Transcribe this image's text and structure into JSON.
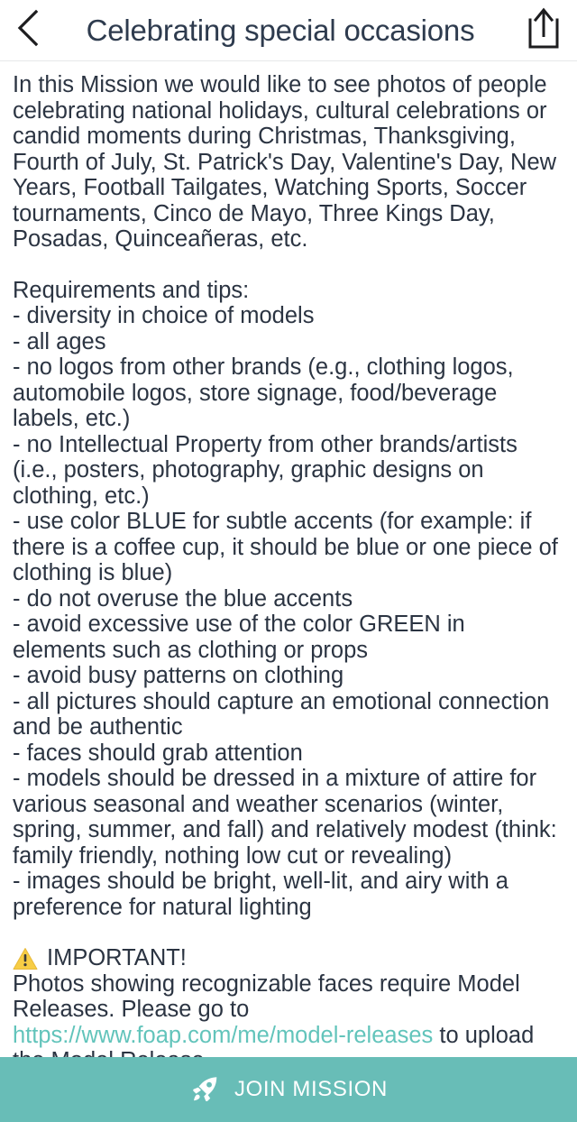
{
  "header": {
    "title": "Celebrating special occasions",
    "back_icon": "chevron-left-icon",
    "share_icon": "share-upload-icon"
  },
  "content": {
    "intro": "In this Mission we would like to see photos of people celebrating national holidays, cultural celebrations or candid moments during Christmas, Thanksgiving, Fourth of July, St. Patrick's Day, Valentine's Day, New Years, Football Tailgates, Watching Sports, Soccer tournaments, Cinco de Mayo, Three Kings Day, Posadas, Quinceañeras, etc.",
    "requirements_heading": "Requirements and tips:",
    "requirements": "- diversity in choice of models\n- all ages\n- no logos from other brands (e.g., clothing logos, automobile logos, store signage, food/beverage labels, etc.)\n- no Intellectual Property from other brands/artists (i.e., posters, photography, graphic designs on clothing, etc.)\n- use color BLUE for subtle accents (for example: if there is a coffee cup, it should be blue or one piece of clothing is blue)\n- do not overuse the blue accents\n- avoid excessive use of the color GREEN in elements such as clothing or props\n- avoid busy patterns on clothing\n- all pictures should capture an emotional connection and be authentic\n- faces should grab attention\n- models should be dressed in a mixture of attire for various seasonal and weather scenarios (winter, spring, summer, and fall) and relatively modest (think: family friendly, nothing low cut or revealing)\n- images should be bright, well-lit, and airy with a preference for natural lighting",
    "important_label": "IMPORTANT!",
    "important_icon": "warning-triangle-icon",
    "important_text_before": "Photos showing recognizable faces require Model Releases. Please go to ",
    "important_link": "https://www.foap.com/me/model-releases",
    "important_text_after": " to upload the Model Release."
  },
  "footer": {
    "join_label": "JOIN MISSION",
    "join_icon": "rocket-icon"
  },
  "colors": {
    "accent_teal": "#68bdb7",
    "link_teal": "#62c4bb",
    "text": "#2b3442",
    "title": "#2e3b4e",
    "warning_yellow": "#f7cd45"
  }
}
